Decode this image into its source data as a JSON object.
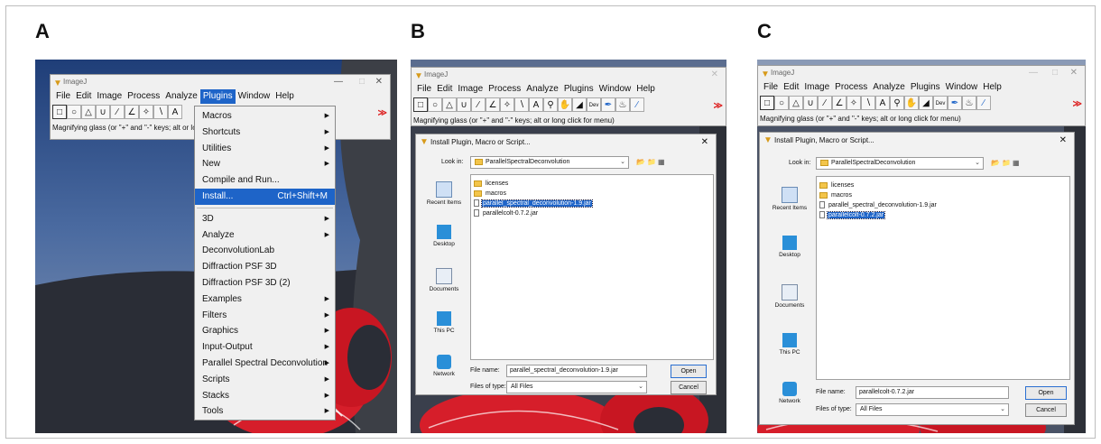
{
  "panel_labels": [
    "A",
    "B",
    "C"
  ],
  "imagej": {
    "title": "ImageJ",
    "menus": [
      "File",
      "Edit",
      "Image",
      "Process",
      "Analyze",
      "Plugins",
      "Window",
      "Help"
    ],
    "status": "Magnifying glass (or \"+\" and \"-\" keys; alt or long click for menu)",
    "status_short": "Magnifying glass (or \"+\" and \"-\" keys; alt or lo",
    "dev_label": "Dev",
    "more_tools": "≫"
  },
  "plugins_menu": [
    {
      "label": "Macros",
      "submenu": true
    },
    {
      "label": "Shortcuts",
      "submenu": true
    },
    {
      "label": "Utilities",
      "submenu": true
    },
    {
      "label": "New",
      "submenu": true
    },
    {
      "label": "Compile and Run...",
      "submenu": false
    },
    {
      "label": "Install...",
      "shortcut": "Ctrl+Shift+M",
      "selected": true
    },
    {
      "separator": true
    },
    {
      "label": "3D",
      "submenu": true
    },
    {
      "label": "Analyze",
      "submenu": true
    },
    {
      "label": "DeconvolutionLab",
      "submenu": false
    },
    {
      "label": "Diffraction PSF 3D",
      "submenu": false
    },
    {
      "label": "Diffraction PSF 3D (2)",
      "submenu": false
    },
    {
      "label": "Examples",
      "submenu": true
    },
    {
      "label": "Filters",
      "submenu": true
    },
    {
      "label": "Graphics",
      "submenu": true
    },
    {
      "label": "Input-Output",
      "submenu": true
    },
    {
      "label": "Parallel Spectral Deconvolution",
      "submenu": true
    },
    {
      "label": "Scripts",
      "submenu": true
    },
    {
      "label": "Stacks",
      "submenu": true
    },
    {
      "label": "Tools",
      "submenu": true
    }
  ],
  "install_dialog": {
    "title": "Install Plugin, Macro or Script...",
    "look_in_label": "Look in:",
    "look_in_value": "ParallelSpectralDeconvolution",
    "places": [
      "Recent Items",
      "Desktop",
      "Documents",
      "This PC",
      "Network"
    ],
    "files": [
      {
        "name": "licenses",
        "type": "folder"
      },
      {
        "name": "macros",
        "type": "folder"
      },
      {
        "name": "parallel_spectral_deconvolution-1.9.jar",
        "type": "file"
      },
      {
        "name": "parallelcolt-0.7.2.jar",
        "type": "file"
      }
    ],
    "file_name_label": "File name:",
    "files_of_type_label": "Files of type:",
    "files_of_type_value": "All Files",
    "open_label": "Open",
    "cancel_label": "Cancel",
    "panel_b_file_name": "parallel_spectral_deconvolution-1.9.jar",
    "panel_c_file_name": "parallelcolt-0.7.2.jar",
    "panel_b_selected_index": 2,
    "panel_c_selected_index": 3
  },
  "colors": {
    "selection": "#1e64c8",
    "folder": "#f3c54a",
    "panel_label": "#111111"
  }
}
